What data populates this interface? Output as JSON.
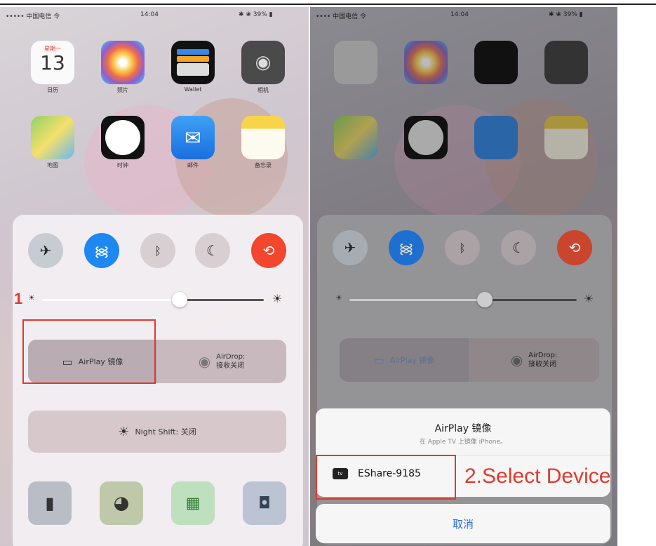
{
  "left": {
    "status": {
      "carrier": "••••• 中国电信 令",
      "time": "14:04",
      "battery": "✱ ❀ 39% ▮"
    },
    "apps": [
      {
        "label": "日历",
        "badge": "13",
        "weekday": "星期一"
      },
      {
        "label": "照片"
      },
      {
        "label": "Wallet"
      },
      {
        "label": "相机"
      },
      {
        "label": "地图"
      },
      {
        "label": "时钟"
      },
      {
        "label": "邮件"
      },
      {
        "label": "备忘录"
      }
    ],
    "airplay_label": "AirPlay 镜像",
    "airdrop_label_1": "AirDrop:",
    "airdrop_label_2": "接收关闭",
    "nightshift_label": "Night Shift: 关闭",
    "brightness": 0.55,
    "step1": "1"
  },
  "right": {
    "status": {
      "carrier": "•••• 中国电信 令",
      "time": "14:04",
      "battery": "✱ ❀ 39% ▮"
    },
    "airplay_label": "AirPlay 镜像",
    "airdrop_label_1": "AirDrop:",
    "airdrop_label_2": "接收关闭",
    "sheet_title": "AirPlay 镜像",
    "sheet_subtitle": "在 Apple TV 上镜像 iPhone。",
    "device_name": "EShare-9185",
    "device_badge": "tv",
    "cancel_label": "取消",
    "step2": "2.Select Device",
    "brightness": 0.55
  },
  "colors": {
    "wifi_blue": "#1e88f0",
    "lock_red": "#f2462e",
    "annotation_red": "#e03a2e"
  }
}
